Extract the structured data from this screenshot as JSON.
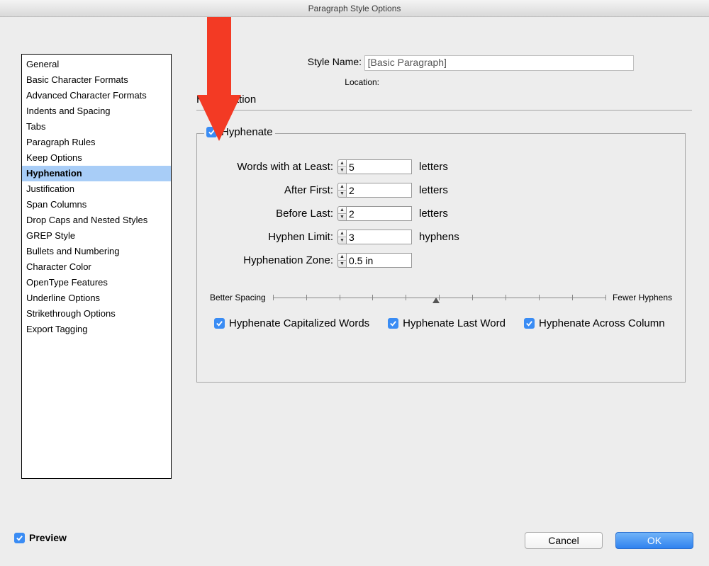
{
  "window": {
    "title": "Paragraph Style Options"
  },
  "header": {
    "styleNameLabel": "Style Name:",
    "styleNameValue": "[Basic Paragraph]",
    "locationLabel": "Location:"
  },
  "section": {
    "title": "Hyphenation"
  },
  "sidebar": {
    "items": [
      "General",
      "Basic Character Formats",
      "Advanced Character Formats",
      "Indents and Spacing",
      "Tabs",
      "Paragraph Rules",
      "Keep Options",
      "Hyphenation",
      "Justification",
      "Span Columns",
      "Drop Caps and Nested Styles",
      "GREP Style",
      "Bullets and Numbering",
      "Character Color",
      "OpenType Features",
      "Underline Options",
      "Strikethrough Options",
      "Export Tagging"
    ],
    "activeIndex": 7
  },
  "fieldset": {
    "legend": "Hyphenate",
    "rows": [
      {
        "label": "Words with at Least:",
        "value": "5",
        "unit": "letters"
      },
      {
        "label": "After First:",
        "value": "2",
        "unit": "letters"
      },
      {
        "label": "Before Last:",
        "value": "2",
        "unit": "letters"
      },
      {
        "label": "Hyphen Limit:",
        "value": "3",
        "unit": "hyphens"
      },
      {
        "label": "Hyphenation Zone:",
        "value": "0.5 in",
        "unit": ""
      }
    ],
    "slider": {
      "leftLabel": "Better Spacing",
      "rightLabel": "Fewer Hyphens"
    },
    "checks": [
      "Hyphenate Capitalized Words",
      "Hyphenate Last Word",
      "Hyphenate Across Column"
    ]
  },
  "footer": {
    "previewLabel": "Preview",
    "cancel": "Cancel",
    "ok": "OK"
  }
}
